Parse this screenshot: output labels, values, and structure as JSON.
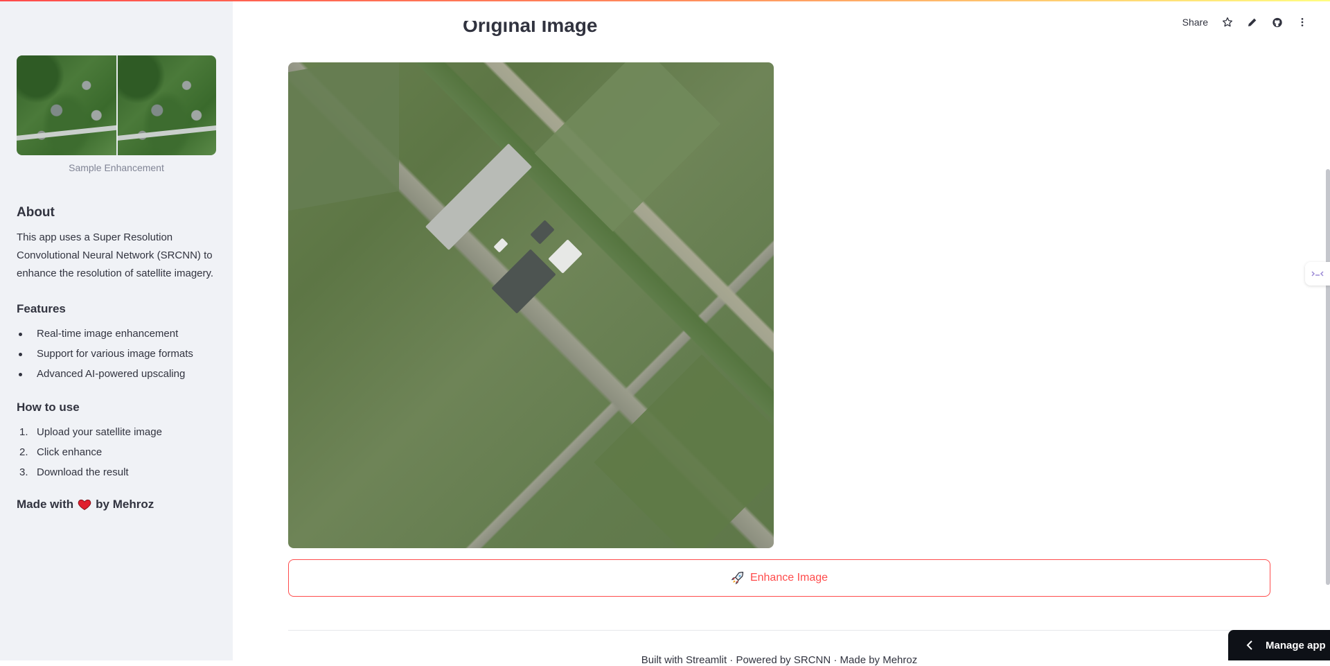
{
  "sidebar": {
    "image_caption": "Sample Enhancement",
    "about_heading": "About",
    "about_text": "This app uses a Super Resolution Convolutional Neural Network (SRCNN) to enhance the resolution of satellite imagery.",
    "features_heading": "Features",
    "features": [
      "Real-time image enhancement",
      "Support for various image formats",
      "Advanced AI-powered upscaling"
    ],
    "howto_heading": "How to use",
    "steps": [
      {
        "num": "1.",
        "text": "Upload your satellite image"
      },
      {
        "num": "2.",
        "text": "Click enhance"
      },
      {
        "num": "3.",
        "text": "Download the result"
      }
    ],
    "made_prefix": "Made with",
    "made_suffix": "by Mehroz"
  },
  "header": {
    "share_label": "Share",
    "icons": [
      "star-icon",
      "pencil-icon",
      "github-icon",
      "more-vertical-icon"
    ]
  },
  "main": {
    "title": "Original Image",
    "enhance_label": "Enhance Image",
    "footer_text": "Built with Streamlit · Powered by SRCNN · Made by Mehroz"
  },
  "manage_app": {
    "label": "Manage app"
  },
  "colors": {
    "accent": "#ff4b4b",
    "sidebar_bg": "#f0f2f6",
    "text": "#31333f",
    "manage_bg": "#0e1117"
  }
}
